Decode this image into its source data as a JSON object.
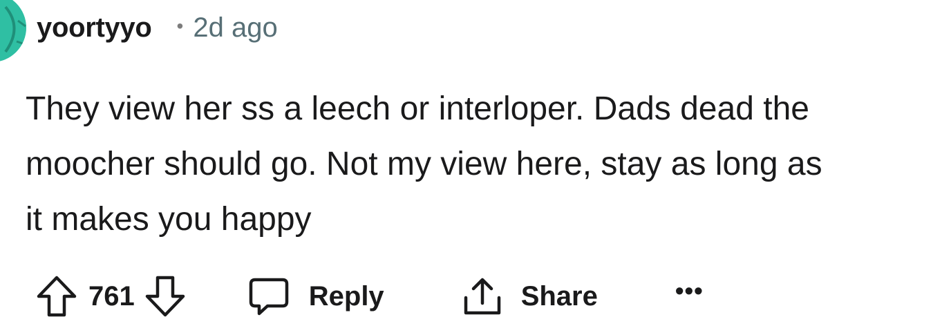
{
  "comment": {
    "author": "yoortyyo",
    "separator": "•",
    "timestamp": "2d ago",
    "body": "They view her ss a leech or interloper. Dads dead the\nmoocher should go. Not my view here, stay as long as\nit makes you happy",
    "score": "761",
    "reply_label": "Reply",
    "share_label": "Share",
    "more_label": "•••"
  },
  "icons": {
    "avatar": "avatar",
    "upvote": "upvote-arrow-icon",
    "downvote": "downvote-arrow-icon",
    "reply": "speech-bubble-icon",
    "share": "share-upload-icon",
    "more": "ellipsis-icon"
  },
  "colors": {
    "avatar_bg": "#2fbfa3",
    "text": "#1a1a1b",
    "meta": "#576f76"
  }
}
